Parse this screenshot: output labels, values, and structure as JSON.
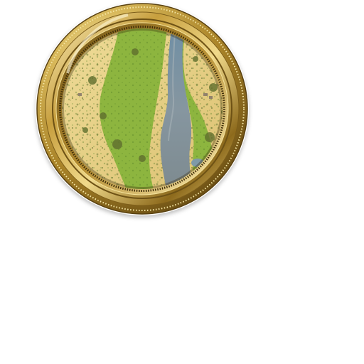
{
  "minimap": {
    "icon": "round-gilded-minimap",
    "frame_colors": {
      "gold_light": "#f3e4a2",
      "gold_mid": "#c9a448",
      "gold_dark": "#7d5e1a",
      "gold_shadow": "#5a4211"
    },
    "terrain_colors": {
      "sand": "#e8d28a",
      "sand_dark": "#d9bd6f",
      "grass": "#8db53f",
      "grass_dark": "#5f8a2c",
      "river": "#7f8f9a",
      "river_light": "#a7b3b8",
      "scrub": "#6d7a3a"
    }
  }
}
